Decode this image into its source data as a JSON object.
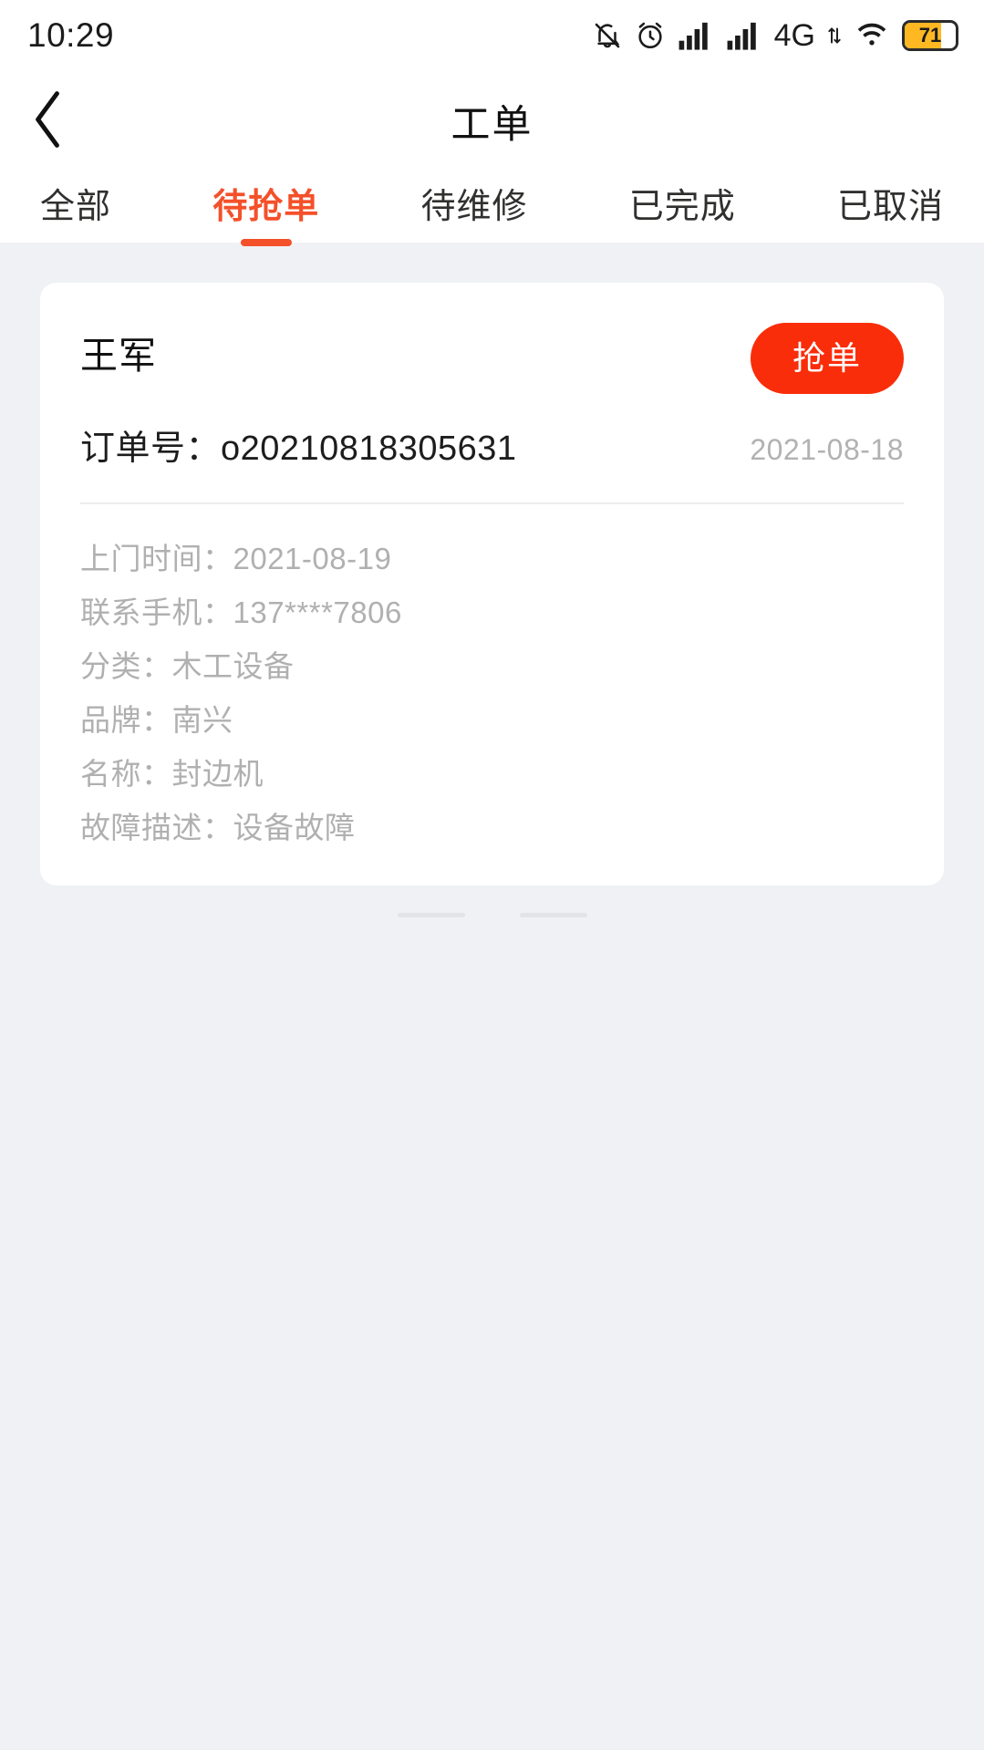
{
  "statusbar": {
    "time": "10:29",
    "battery_percent": "71",
    "network_label": "4G",
    "icons": [
      "mute-bell-icon",
      "alarm-clock-icon",
      "signal-bars-icon",
      "signal-bars-icon",
      "4g-label",
      "wifi-icon",
      "battery-icon"
    ]
  },
  "navbar": {
    "back_icon": "chevron-left-icon",
    "title": "工单"
  },
  "tabs": [
    {
      "label": "全部",
      "active": false
    },
    {
      "label": "待抢单",
      "active": true
    },
    {
      "label": "待维修",
      "active": false
    },
    {
      "label": "已完成",
      "active": false
    },
    {
      "label": "已取消",
      "active": false
    }
  ],
  "order_card": {
    "customer_name": "王军",
    "grab_button_label": "抢单",
    "order_no_label": "订单号：o20210818305631",
    "order_date": "2021-08-18",
    "details": [
      "上门时间：2021-08-19",
      "联系手机：137****7806",
      "分类：木工设备",
      "品牌：南兴",
      "名称：封边机",
      "故障描述：设备故障"
    ]
  },
  "list_end": {
    "text": ""
  },
  "colors": {
    "accent": "#f4502a",
    "button": "#fa2d0a",
    "background": "#f0f1f5",
    "card": "#ffffff",
    "muted_text": "#b0b0b0",
    "battery": "#ffb822"
  }
}
